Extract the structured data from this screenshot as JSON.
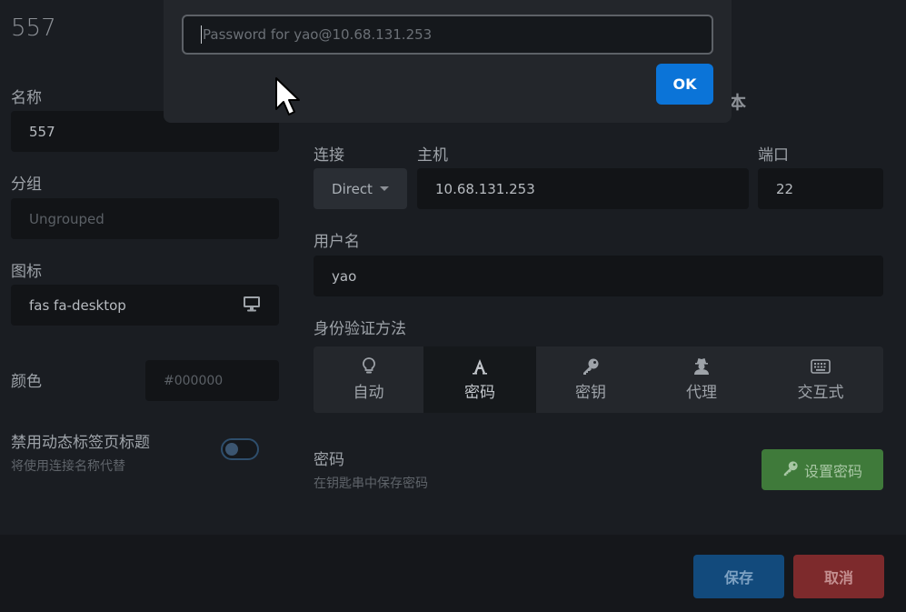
{
  "title_num": "557",
  "left": {
    "name_label": "名称",
    "name_value": "557",
    "group_label": "分组",
    "group_placeholder": "Ungrouped",
    "icon_label": "图标",
    "icon_value": "fas fa-desktop",
    "color_label": "颜色",
    "color_placeholder": "#000000",
    "disable_dynamic_label": "禁用动态标签页标题",
    "disable_dynamic_sub": "将使用连接名称代替"
  },
  "right": {
    "partial_heading": "本",
    "connection_label": "连接",
    "connection_value": "Direct",
    "host_label": "主机",
    "host_value": "10.68.131.253",
    "port_label": "端口",
    "port_value": "22",
    "username_label": "用户名",
    "username_value": "yao",
    "auth_label": "身份验证方法",
    "auth_methods": [
      {
        "label": "自动",
        "icon": "lightbulb-icon"
      },
      {
        "label": "密码",
        "icon": "font-a-icon",
        "active": true
      },
      {
        "label": "密钥",
        "icon": "key-icon"
      },
      {
        "label": "代理",
        "icon": "user-secret-icon"
      },
      {
        "label": "交互式",
        "icon": "keyboard-icon"
      }
    ],
    "password_label": "密码",
    "password_sub": "在钥匙串中保存密码",
    "set_password_label": "设置密码"
  },
  "footer": {
    "save_label": "保存",
    "cancel_label": "取消"
  },
  "modal": {
    "input_placeholder": "Password for yao@10.68.131.253",
    "ok_label": "OK"
  },
  "colors": {
    "ok_blue": "#0b74d8",
    "set_password_green": "#3f7a3a",
    "save_blue": "#124a7c",
    "cancel_red": "#7d2a2c"
  }
}
